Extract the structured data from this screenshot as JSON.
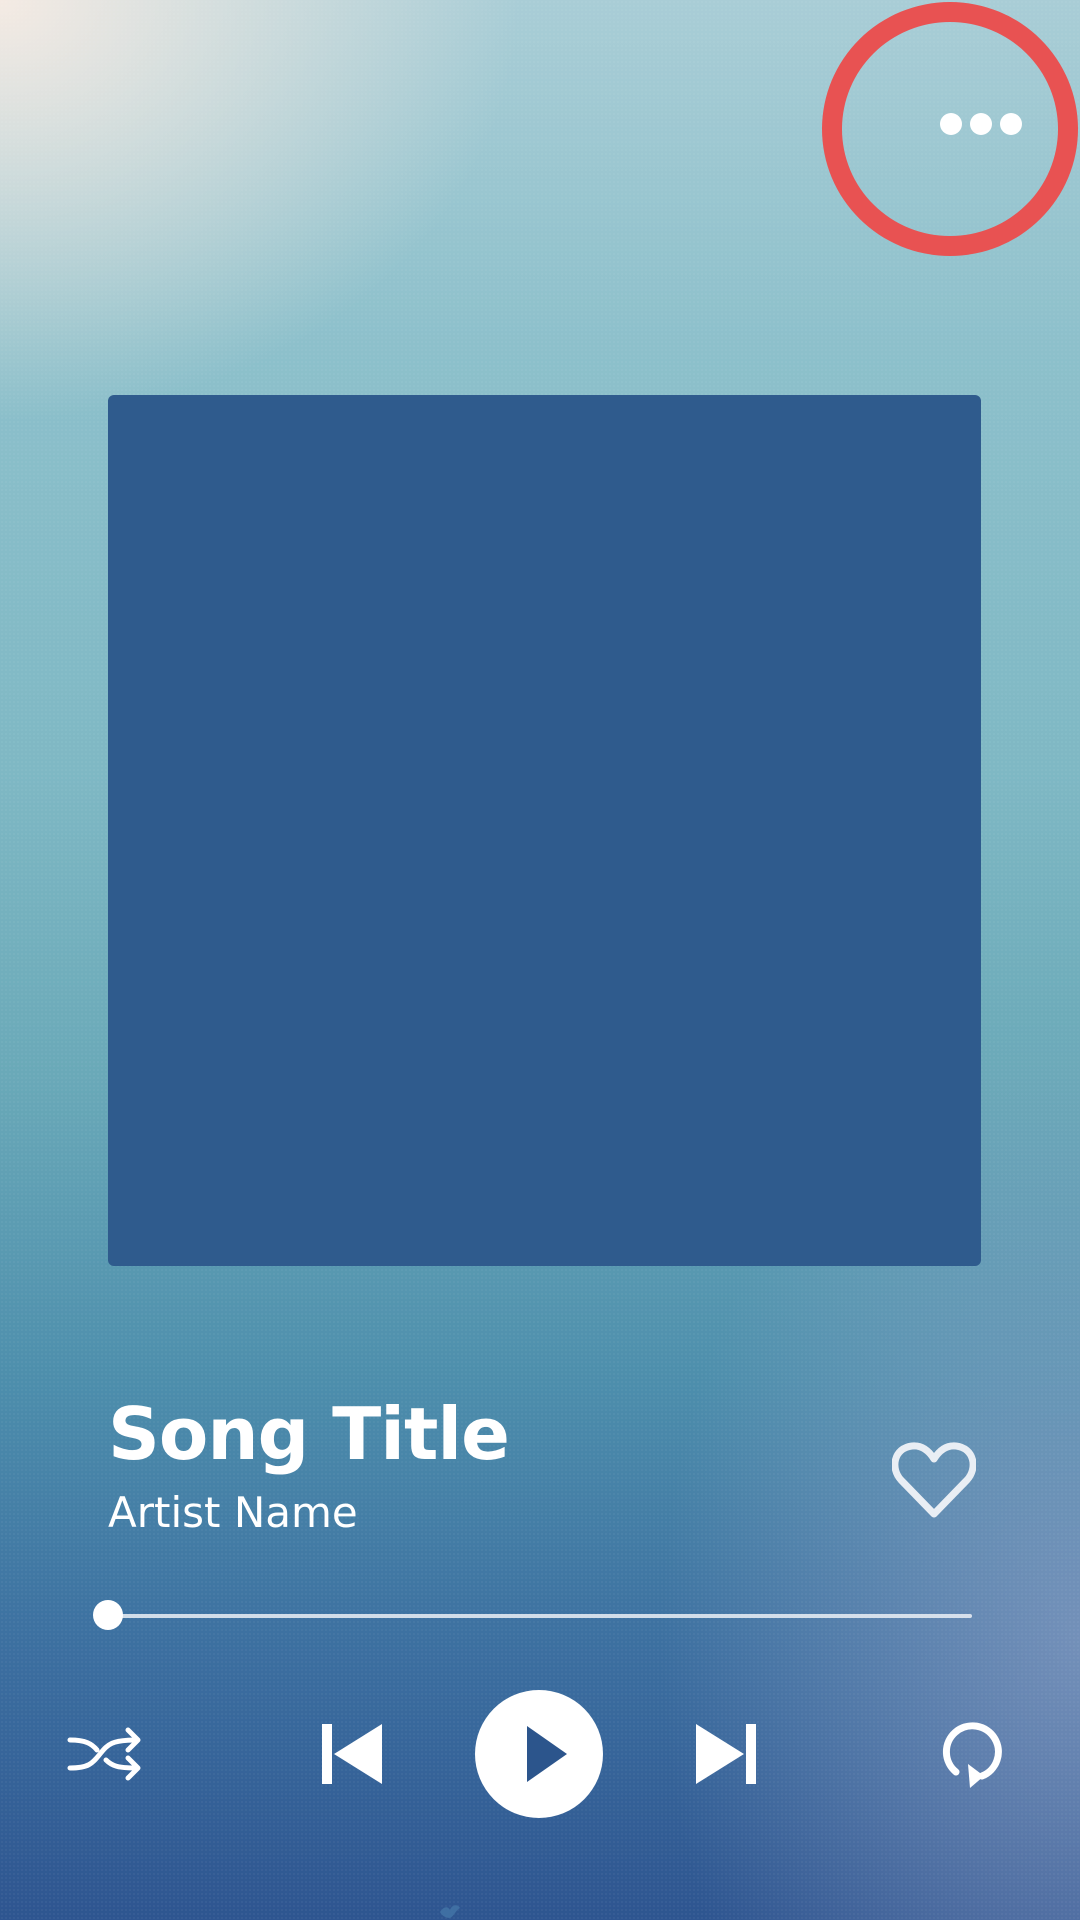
{
  "player": {
    "song_title": "Song Title",
    "artist_name": "Artist Name",
    "progress_fraction": 0.0
  },
  "icons": {
    "more": "more-horizontal-icon",
    "like": "heart-outline-icon",
    "shuffle": "shuffle-icon",
    "previous": "skip-previous-icon",
    "play": "play-icon",
    "next": "skip-next-icon",
    "repeat": "repeat-icon"
  },
  "colors": {
    "album_art": "#2f5b8d",
    "highlight_ring": "#e85252",
    "foreground": "#ffffff"
  }
}
